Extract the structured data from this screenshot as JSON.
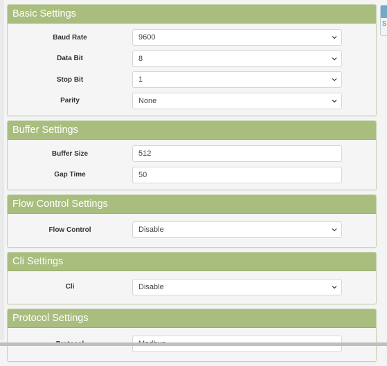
{
  "panels": [
    {
      "title": "Basic Settings",
      "fields": [
        {
          "label": "Baud Rate",
          "type": "select",
          "value": "9600"
        },
        {
          "label": "Data Bit",
          "type": "select",
          "value": "8"
        },
        {
          "label": "Stop Bit",
          "type": "select",
          "value": "1"
        },
        {
          "label": "Parity",
          "type": "select",
          "value": "None"
        }
      ]
    },
    {
      "title": "Buffer Settings",
      "fields": [
        {
          "label": "Buffer Size",
          "type": "input",
          "value": "512"
        },
        {
          "label": "Gap Time",
          "type": "input",
          "value": "50"
        }
      ]
    },
    {
      "title": "Flow Control Settings",
      "fields": [
        {
          "label": "Flow Control",
          "type": "select",
          "value": "Disable"
        }
      ]
    },
    {
      "title": "Cli Settings",
      "fields": [
        {
          "label": "Cli",
          "type": "select",
          "value": "Disable"
        }
      ]
    },
    {
      "title": "Protocol Settings",
      "fields": [
        {
          "label": "Protocol",
          "type": "select",
          "value": "Modbus"
        }
      ]
    }
  ],
  "side_widget": {
    "text": "S"
  },
  "colors": {
    "panel_header": "#a9bd7e",
    "side_header": "#74a9c6"
  }
}
